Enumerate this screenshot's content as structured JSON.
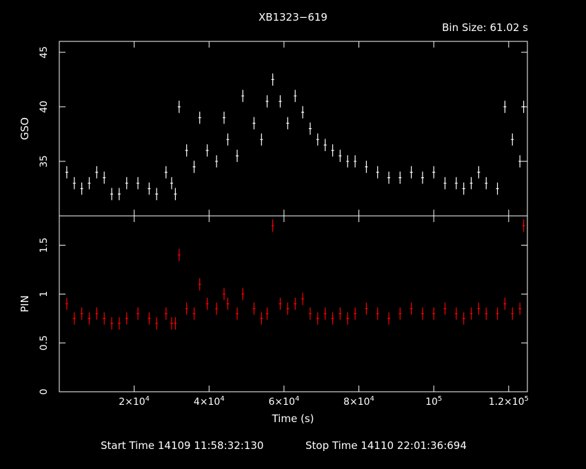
{
  "title": "XB1323−619",
  "bin_size": "Bin Size: 61.02 s",
  "footer": {
    "start": "Start Time 14109 11:58:32:130",
    "stop": "Stop Time 14110 22:01:36:694"
  },
  "colors": {
    "gso": "#ffffff",
    "pin": "#ff0000",
    "axes": "#ffffff",
    "background": "#000000"
  },
  "chart_data": [
    {
      "type": "scatter",
      "xlabel": "Time (s)",
      "ylabel": "GSO",
      "x_ticks": [
        {
          "v": 20000,
          "l": "2×10^4"
        },
        {
          "v": 40000,
          "l": "4×10^4"
        },
        {
          "v": 60000,
          "l": "6×10^4"
        },
        {
          "v": 80000,
          "l": "8×10^4"
        },
        {
          "v": 100000,
          "l": "10^5"
        },
        {
          "v": 120000,
          "l": "1.2×10^5"
        }
      ],
      "xlim": [
        0,
        125000
      ],
      "ylim": [
        30,
        46
      ],
      "y_ticks": [
        35,
        40,
        45
      ],
      "series": [
        {
          "x": [
            2000,
            4000,
            6000,
            8000,
            10000,
            12000,
            14000,
            16000,
            18000,
            21000,
            24000,
            26000,
            28500,
            30000,
            31000,
            32000,
            34000,
            36000,
            37500,
            39500,
            42000,
            44000,
            45000,
            47500,
            49000,
            52000,
            54000,
            55500,
            57000,
            59000,
            61000,
            63000,
            65000,
            67000,
            69000,
            71000,
            73000,
            75000,
            77000,
            79000,
            82000,
            85000,
            88000,
            91000,
            94000,
            97000,
            100000,
            103000,
            106000,
            108000,
            110000,
            112000,
            114000,
            117000,
            119000,
            121000,
            123000,
            124000
          ],
          "y": [
            34,
            33,
            32.5,
            33,
            34,
            33.5,
            32,
            32,
            33,
            33,
            32.5,
            32,
            34,
            33,
            32,
            40,
            36,
            34.5,
            39,
            36,
            35,
            39,
            37,
            35.5,
            41,
            38.5,
            37,
            40.5,
            42.5,
            40.5,
            38.5,
            41,
            39.5,
            38,
            37,
            36.5,
            36,
            35.5,
            35,
            35,
            34.5,
            34,
            33.5,
            33.5,
            34,
            33.5,
            34,
            33,
            33,
            32.5,
            33,
            34,
            33,
            32.5,
            40,
            37,
            35,
            40
          ]
        }
      ]
    },
    {
      "type": "scatter",
      "xlabel": "Time (s)",
      "ylabel": "PIN",
      "x_ticks": [
        {
          "v": 20000,
          "l": "2×10^4"
        },
        {
          "v": 40000,
          "l": "4×10^4"
        },
        {
          "v": 60000,
          "l": "6×10^4"
        },
        {
          "v": 80000,
          "l": "8×10^4"
        },
        {
          "v": 100000,
          "l": "10^5"
        },
        {
          "v": 120000,
          "l": "1.2×10^5"
        }
      ],
      "xlim": [
        0,
        125000
      ],
      "ylim": [
        0,
        1.8
      ],
      "y_ticks": [
        0,
        0.5,
        1,
        1.5
      ],
      "series": [
        {
          "x": [
            2000,
            4000,
            6000,
            8000,
            10000,
            12000,
            14000,
            16000,
            18000,
            21000,
            24000,
            26000,
            28500,
            30000,
            31000,
            32000,
            34000,
            36000,
            37500,
            39500,
            42000,
            44000,
            45000,
            47500,
            49000,
            52000,
            54000,
            55500,
            57000,
            59000,
            61000,
            63000,
            65000,
            67000,
            69000,
            71000,
            73000,
            75000,
            77000,
            79000,
            82000,
            85000,
            88000,
            91000,
            94000,
            97000,
            100000,
            103000,
            106000,
            108000,
            110000,
            112000,
            114000,
            117000,
            119000,
            121000,
            123000,
            124000
          ],
          "y": [
            0.9,
            0.75,
            0.8,
            0.75,
            0.8,
            0.75,
            0.7,
            0.7,
            0.75,
            0.8,
            0.75,
            0.7,
            0.8,
            0.7,
            0.7,
            1.4,
            0.85,
            0.8,
            1.1,
            0.9,
            0.85,
            1.0,
            0.9,
            0.8,
            1.0,
            0.85,
            0.75,
            0.8,
            1.7,
            0.9,
            0.85,
            0.9,
            0.95,
            0.8,
            0.75,
            0.8,
            0.75,
            0.8,
            0.75,
            0.8,
            0.85,
            0.8,
            0.75,
            0.8,
            0.85,
            0.8,
            0.8,
            0.85,
            0.8,
            0.75,
            0.8,
            0.85,
            0.8,
            0.8,
            0.9,
            0.8,
            0.85,
            1.7
          ]
        }
      ]
    }
  ]
}
